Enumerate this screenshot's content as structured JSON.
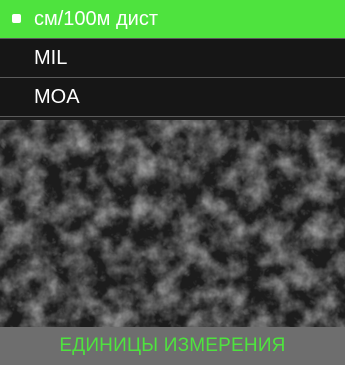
{
  "menu": {
    "items": [
      {
        "label": "см/100м дист",
        "selected": true
      },
      {
        "label": "MIL",
        "selected": false
      },
      {
        "label": "MOA",
        "selected": false
      }
    ]
  },
  "footer": {
    "title": "ЕДИНИЦЫ ИЗМЕРЕНИЯ"
  },
  "colors": {
    "accent": "#4ee33e",
    "menu_background": "#161616",
    "footer_background": "#6e6e6e",
    "text": "#ffffff"
  },
  "icons": {
    "selection_marker": "selected-bullet-icon"
  }
}
